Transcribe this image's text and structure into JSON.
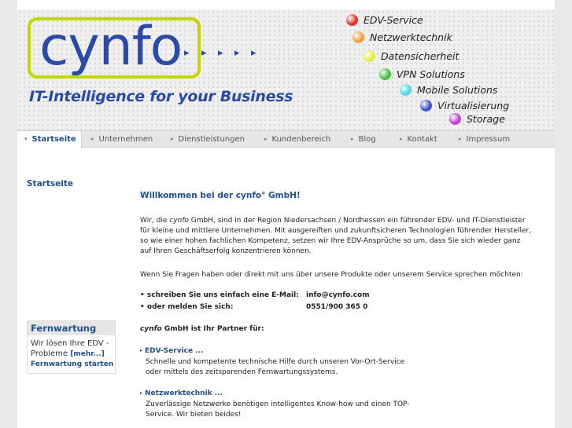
{
  "logo": {
    "text": "cynfo",
    "arrows": "▸",
    "tagline": "IT-Intelligence for your Business"
  },
  "services": [
    {
      "label": "EDV-Service",
      "color": "#e8322c"
    },
    {
      "label": "Netzwerktechnik",
      "color": "#f0a040"
    },
    {
      "label": "Datensicherheit",
      "color": "#e8ec3c"
    },
    {
      "label": "VPN Solutions",
      "color": "#44c040"
    },
    {
      "label": "Mobile Solutions",
      "color": "#50d8e8"
    },
    {
      "label": "Virtualisierung",
      "color": "#4050c8"
    },
    {
      "label": "Storage",
      "color": "#c040d8"
    }
  ],
  "nav": {
    "items": [
      {
        "label": "Startseite"
      },
      {
        "label": "Unternehmen"
      },
      {
        "label": "Dienstleistungen"
      },
      {
        "label": "Kundenbereich"
      },
      {
        "label": "Blog"
      },
      {
        "label": "Kontakt"
      },
      {
        "label": "Impressum"
      }
    ],
    "active_marker": "▾",
    "marker": "▸"
  },
  "sidebar": {
    "title": "Startseite",
    "fernwartung": {
      "title": "Fernwartung",
      "text": "Wir lösen Ihre EDV - Probleme",
      "more": "[mehr...]",
      "start": "Fernwartung starten"
    }
  },
  "main": {
    "welcome": "Willkommen bei der cynfo° GmbH!",
    "intro_lead": "Wir, die ",
    "intro_brand": "cynfo",
    "intro_rest": " GmbH, sind in der Region Niedersachsen / Nordhessen ein führender EDV- und IT-Dienstleister für kleine und mittlere Unternehmen. Mit ausgereiften und zukunftsicheren Technologien führender Hersteller, so wie einer hohen fachlichen Kompetenz, setzen wir Ihre EDV-Ansprüche so um, dass Sie sich wieder ganz auf Ihren Geschäftserfolg konzentrieren können.",
    "contact_intro": "Wenn Sie Fragen haben oder direkt mit uns über unsere Produkte oder unserem Service sprechen möchten:",
    "contact_email_label": "• schreiben Sie uns einfach eine E-Mail:",
    "contact_email": "info@cynfo.com",
    "contact_phone_label": "• oder melden Sie sich:",
    "contact_phone": "0551/900 365 0",
    "partner_brand": "cynfo",
    "partner_rest": " GmbH ist Ihr Partner für:",
    "blocks": [
      {
        "title": "EDV-Service ...",
        "desc": "Schnelle und kompetente technische Hilfe durch unseren Vor-Ort-Service oder mittels des zeitsparenden Fernwartungssystems."
      },
      {
        "title": "Netzwerktechnik ...",
        "desc": "Zuverlässige Netzwerke benötigen intelligentes Know-how und einen TOP-Service. Wir bieten beides!"
      }
    ]
  }
}
